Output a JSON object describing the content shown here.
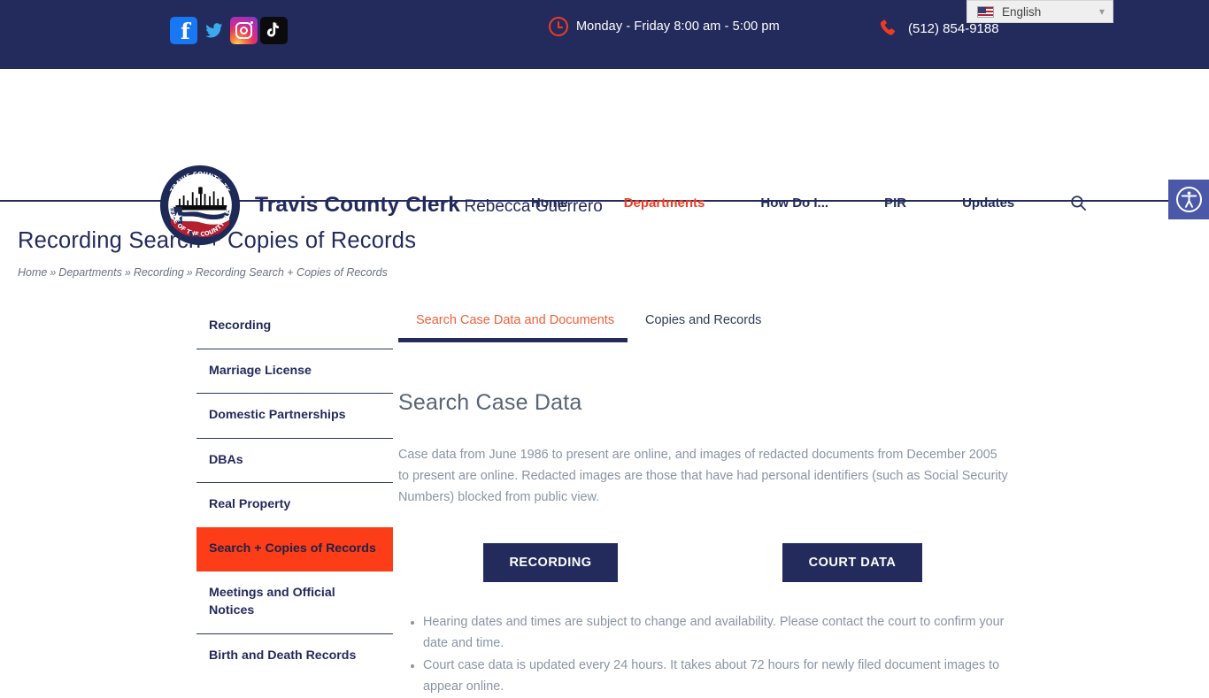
{
  "topbar": {
    "social": [
      {
        "name": "facebook",
        "label": "Facebook"
      },
      {
        "name": "twitter",
        "label": "Twitter"
      },
      {
        "name": "instagram",
        "label": "Instagram"
      },
      {
        "name": "tiktok",
        "label": "TikTok"
      }
    ],
    "hours": "Monday - Friday 8:00 am - 5:00 pm",
    "phone": "(512) 854-9188",
    "language": {
      "selected": "English",
      "flag": "us-flag-icon",
      "chevron": "⌄"
    },
    "bg_color": "#232b5d"
  },
  "header": {
    "seal": {
      "top_text": "TRAVIS COUNTY, TX",
      "bottom_text": "OFFICE OF THE COUNTY CLERK"
    },
    "brand_line1": "Travis County Clerk",
    "brand_line2": "Rebecca Guerrero",
    "nav": [
      {
        "label": "Home",
        "active": false
      },
      {
        "label": "Departments",
        "active": true
      },
      {
        "label": "How Do I...",
        "active": false
      },
      {
        "label": "PIR",
        "active": false
      },
      {
        "label": "Updates",
        "active": false
      }
    ],
    "search_icon": "search-icon",
    "accent_color": "#f03b20"
  },
  "accessibility": {
    "icon": "accessibility-icon",
    "bg_color": "#4b58a8"
  },
  "page": {
    "title": "Recording Search + Copies of Records",
    "breadcrumb": [
      "Home",
      "Departments",
      "Recording",
      "Recording Search + Copies of Records"
    ],
    "breadcrumb_separator": "»"
  },
  "sidebar": {
    "items": [
      {
        "label": "Recording",
        "active": false
      },
      {
        "label": "Marriage License",
        "active": false
      },
      {
        "label": "Domestic Partnerships",
        "active": false
      },
      {
        "label": "DBAs",
        "active": false
      },
      {
        "label": "Real Property",
        "active": false
      },
      {
        "label": "Search + Copies of Records",
        "active": true
      },
      {
        "label": "Meetings and Official Notices",
        "active": false
      },
      {
        "label": "Birth and Death Records",
        "active": false
      }
    ],
    "active_bg": "#fc3d17"
  },
  "main": {
    "tabs": [
      {
        "label": "Search Case Data and Documents",
        "active": true
      },
      {
        "label": "Copies and Records",
        "active": false
      }
    ],
    "heading": "Search Case Data",
    "paragraph": "Case data from June 1986 to present are online, and images of redacted documents from December 2005 to present are online. Redacted images are those that have had personal identifiers (such as Social Security Numbers) blocked from public view.",
    "buttons": [
      {
        "label": "RECORDING"
      },
      {
        "label": "COURT DATA"
      }
    ],
    "notes": [
      "Hearing dates and times are subject to change and availability. Please contact the court to confirm your date and time.",
      "Court case data is updated every 24 hours. It takes about 72 hours for newly filed document images to appear online."
    ]
  }
}
